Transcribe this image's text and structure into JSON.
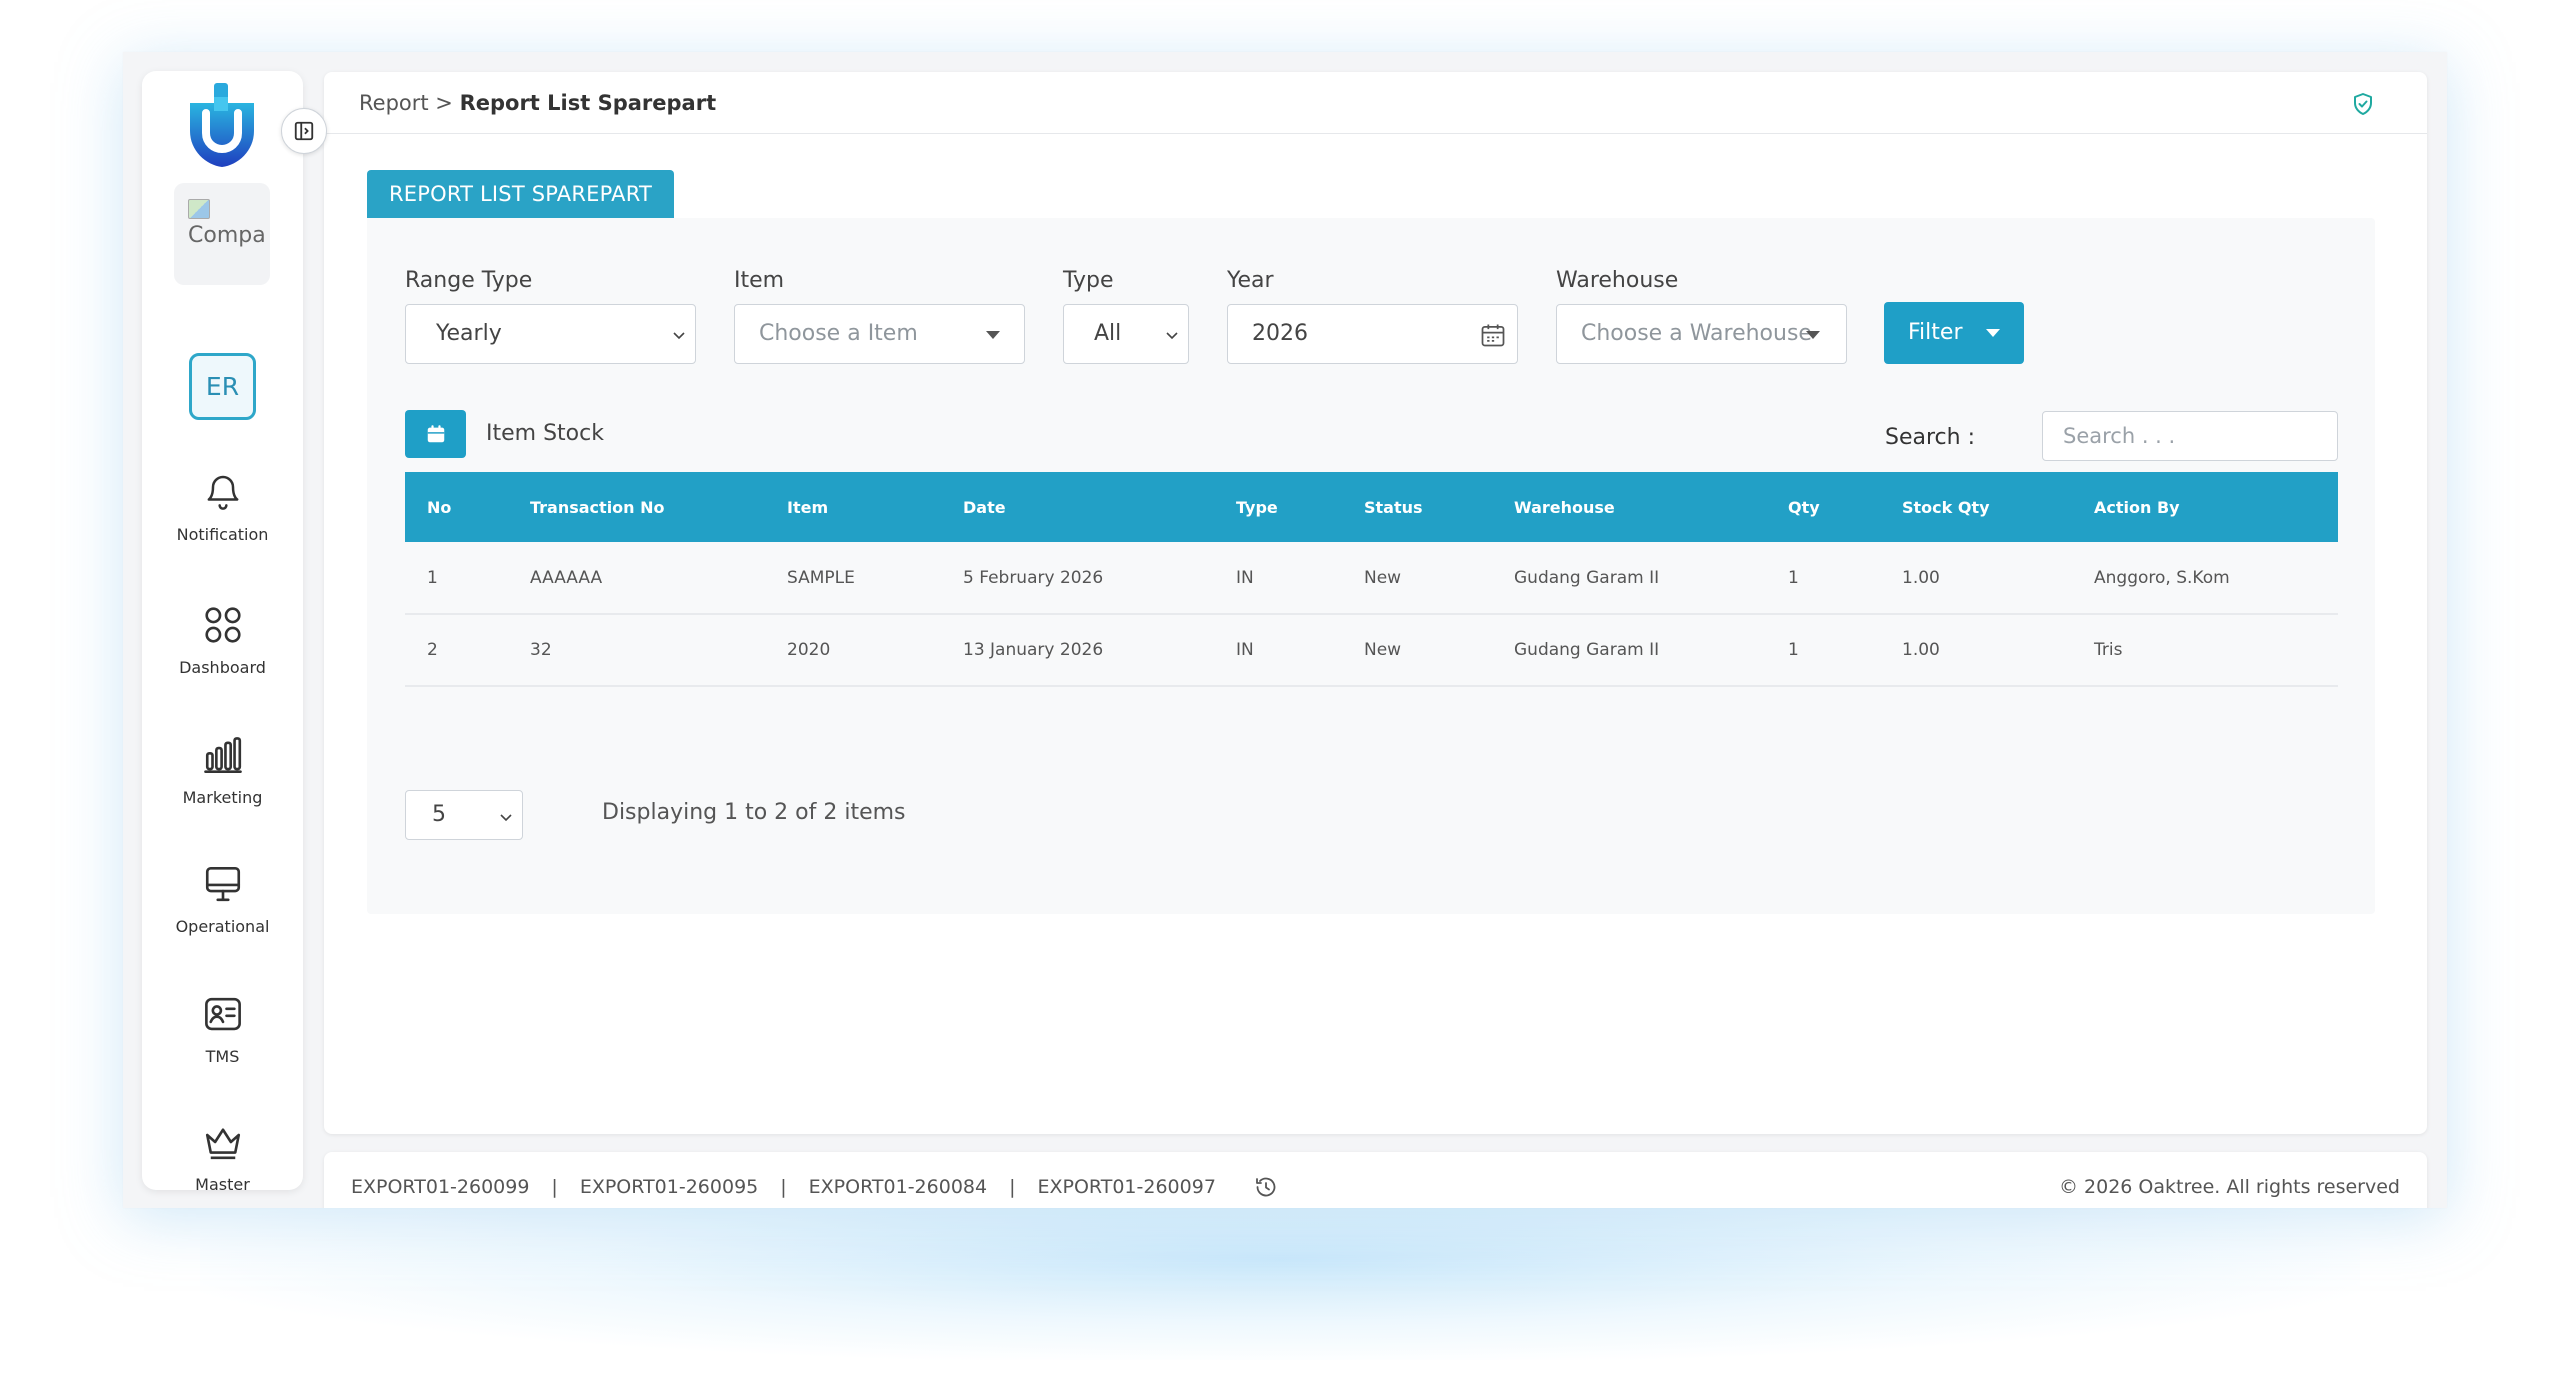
{
  "sidebar": {
    "company_img_alt": "Compa",
    "avatar_initials": "ER",
    "items": [
      {
        "label": "Notification",
        "icon": "bell-icon"
      },
      {
        "label": "Dashboard",
        "icon": "grid-icon"
      },
      {
        "label": "Marketing",
        "icon": "bar-chart-icon"
      },
      {
        "label": "Operational",
        "icon": "monitor-icon"
      },
      {
        "label": "TMS",
        "icon": "id-card-icon"
      },
      {
        "label": "Master",
        "icon": "crown-icon"
      }
    ]
  },
  "breadcrumb": {
    "parent": "Report >",
    "current": "Report List Sparepart"
  },
  "card": {
    "tab_label": "REPORT LIST SPAREPART"
  },
  "filters": {
    "range_type": {
      "label": "Range Type",
      "value": "Yearly"
    },
    "item": {
      "label": "Item",
      "placeholder": "Choose a Item"
    },
    "type": {
      "label": "Type",
      "value": "All"
    },
    "year": {
      "label": "Year",
      "value": "2026"
    },
    "warehouse": {
      "label": "Warehouse",
      "placeholder": "Choose a Warehouse"
    },
    "filter_button": "Filter"
  },
  "toolbar": {
    "item_stock_label": "Item Stock",
    "search_label": "Search :",
    "search_placeholder": "Search . . ."
  },
  "table": {
    "columns": [
      "No",
      "Transaction No",
      "Item",
      "Date",
      "Type",
      "Status",
      "Warehouse",
      "Qty",
      "Stock Qty",
      "Action By"
    ],
    "rows": [
      [
        "1",
        "AAAAAA",
        "SAMPLE",
        "5 February 2026",
        "IN",
        "New",
        "Gudang Garam II",
        "1",
        "1.00",
        "Anggoro, S.Kom"
      ],
      [
        "2",
        "32",
        "2020",
        "13 January 2026",
        "IN",
        "New",
        "Gudang Garam II",
        "1",
        "1.00",
        "Tris"
      ]
    ]
  },
  "pagination": {
    "page_size": "5",
    "summary": "Displaying 1 to 2 of 2 items"
  },
  "footer": {
    "exports": [
      "EXPORT01-260099",
      "EXPORT01-260095",
      "EXPORT01-260084",
      "EXPORT01-260097"
    ],
    "copyright": "© 2026 Oaktree. All rights reserved"
  },
  "colors": {
    "accent": "#22a0c6",
    "brand_blue": "#1f5fc9"
  }
}
